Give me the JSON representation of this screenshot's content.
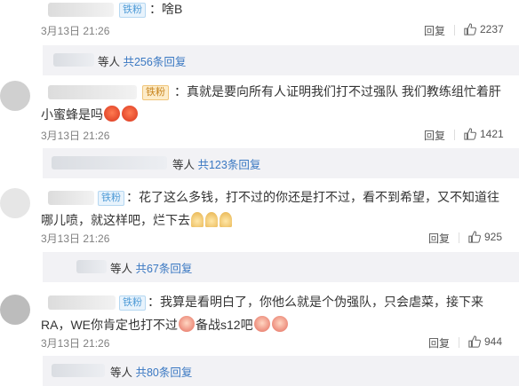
{
  "comments": [
    {
      "badge": "铁粉",
      "text": "：啥B",
      "time": "3月13日 21:26",
      "reply_label": "回复",
      "likes": "2237",
      "subreplies": {
        "prefix": "等人 ",
        "link": "共256条回复"
      }
    },
    {
      "badge": "铁粉",
      "text": "：真就是要向所有人证明我们打不过强队 我们教练组忙着肝小蜜蜂是吗",
      "time": "3月13日 21:26",
      "reply_label": "回复",
      "likes": "1421",
      "subreplies": {
        "prefix": "等人 ",
        "link": "共123条回复"
      }
    },
    {
      "badge": "铁粉",
      "text": "：花了这么多钱，打不过的你还是打不过，看不到希望，又不知道往哪儿喷，就这样吧，烂下去",
      "time": "3月13日 21:26",
      "reply_label": "回复",
      "likes": "925",
      "subreplies": {
        "prefix": "等人 ",
        "link": "共67条回复"
      }
    },
    {
      "badge": "铁粉",
      "text_a": "：我算是看明白了，你他么就是个伪强队，只会虐菜，接下来RA，WE你肯定也打不过",
      "text_b": "备战s12吧",
      "time": "3月13日 21:26",
      "reply_label": "回复",
      "likes": "944",
      "subreplies": {
        "prefix": "等人 ",
        "link": "共80条回复"
      }
    }
  ]
}
